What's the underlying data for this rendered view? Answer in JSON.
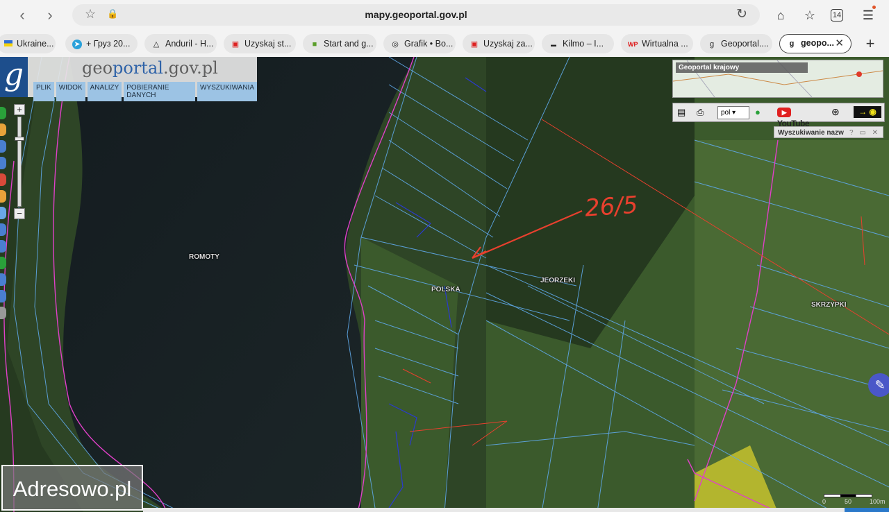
{
  "browser": {
    "url": "mapy.geoportal.gov.pl",
    "tab_count": "14",
    "tabs": [
      {
        "label": "Ukraine...",
        "icon": "ukraine-flag-icon"
      },
      {
        "label": "+ Груз 20...",
        "icon": "telegram-icon"
      },
      {
        "label": "Anduril - H...",
        "icon": "anduril-icon"
      },
      {
        "label": "Uzyskaj st...",
        "icon": "gov-crest-icon"
      },
      {
        "label": "Start and g...",
        "icon": "shopify-icon"
      },
      {
        "label": "Grafik • Bo...",
        "icon": "globe-icon"
      },
      {
        "label": "Uzyskaj za...",
        "icon": "gov-crest-icon"
      },
      {
        "label": "Kilmo – I...",
        "icon": "kilmo-icon"
      },
      {
        "label": "Wirtualna ...",
        "icon": "wp-icon"
      },
      {
        "label": "Geoportal....",
        "icon": "geoportal-icon"
      },
      {
        "label": "geopo...",
        "icon": "geoportal-icon",
        "active": true
      }
    ]
  },
  "geoportal": {
    "logo_letter": "g",
    "title_part1": "geo",
    "title_part2": "portal",
    "title_part3": ".gov.pl",
    "menu": [
      "PLIK",
      "WIDOK",
      "ANALIZY",
      "POBIERANIE DANYCH",
      "WYSZUKIWANIA"
    ],
    "zoom_in": "+",
    "zoom_out": "−",
    "overview_label": "Geoportal krajowy",
    "language": "pol",
    "youtube_label": "YouTube",
    "search_panel_title": "Wyszukiwanie nazw",
    "search_panel_controls": "? ▭ ✕"
  },
  "map": {
    "labels": [
      "ROMOTY",
      "POLSKA",
      "JEORZEKI",
      "SKRZYPKI"
    ],
    "annotation": "26/5",
    "scale_labels": [
      "0",
      "50",
      "100m"
    ]
  },
  "watermark": "Adresowo.pl",
  "colors": {
    "parcel_lines": "#5fa8e8",
    "boundary": "#e040c8",
    "annotation": "#e8402e",
    "gov_blue": "#2f63a8"
  }
}
